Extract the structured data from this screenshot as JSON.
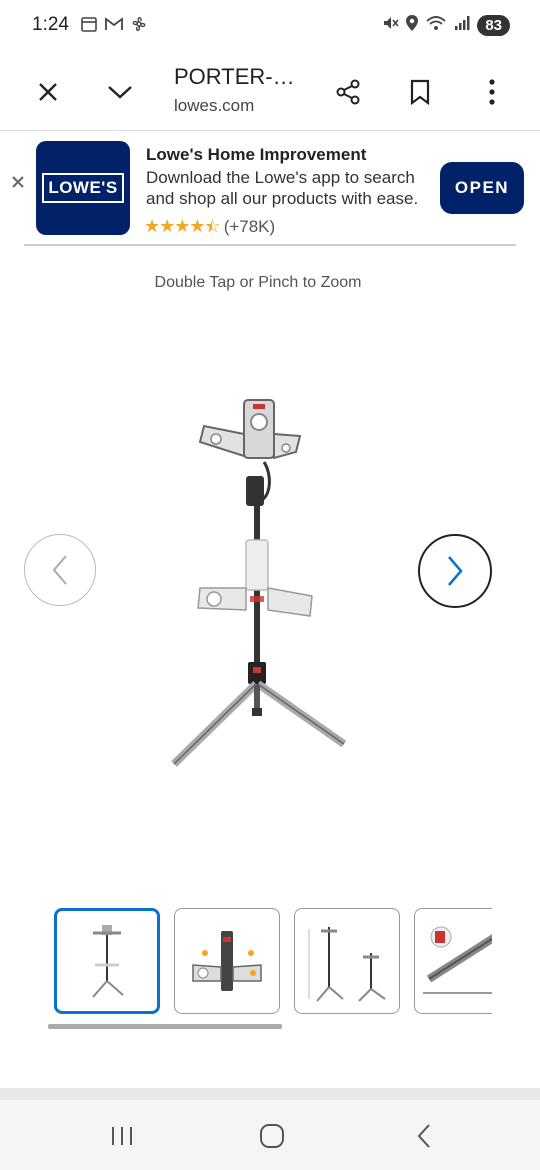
{
  "status": {
    "time": "1:24",
    "battery": "83",
    "icons_left": [
      "calendar-icon",
      "gmail-icon",
      "fan-icon"
    ],
    "icons_right": [
      "mute-icon",
      "location-icon",
      "wifi-icon",
      "signal-icon"
    ]
  },
  "browser": {
    "page_title": "PORTER-…",
    "domain": "lowes.com"
  },
  "app_banner": {
    "app_name": "Lowe's Home Improvement",
    "description": "Download the Lowe's app to search and shop all our products with ease.",
    "rating_stars": 4.5,
    "rating_count": "(+78K)",
    "logo_text": "LOWE'S",
    "open_label": "OPEN",
    "brand_color": "#012169"
  },
  "gallery": {
    "zoom_hint": "Double Tap or Pinch to Zoom",
    "thumbnail_count": 4,
    "selected_index": 0,
    "accent_color": "#0972ce"
  }
}
